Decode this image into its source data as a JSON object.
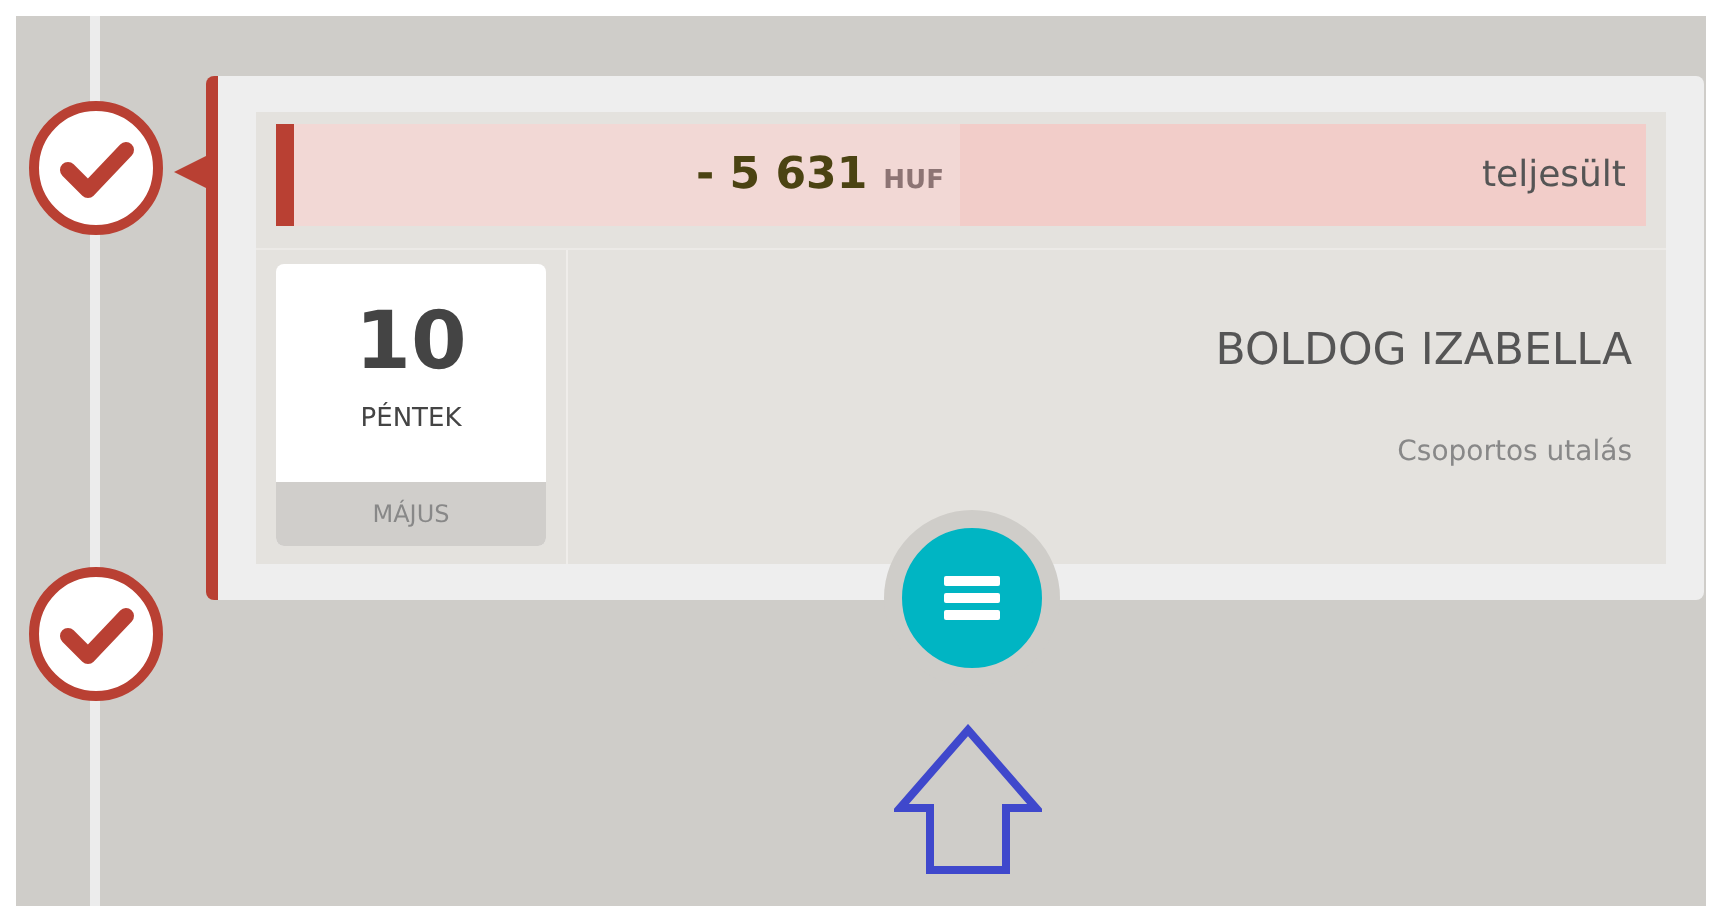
{
  "timeline_markers": [
    {
      "kind": "check"
    },
    {
      "kind": "check"
    }
  ],
  "transaction": {
    "amount": "- 5 631",
    "currency": "HUF",
    "status": "teljesült",
    "day": "10",
    "weekday": "PÉNTEK",
    "month": "MÁJUS",
    "name": "BOLDOG IZABELLA",
    "type": "Csoportos utalás"
  }
}
